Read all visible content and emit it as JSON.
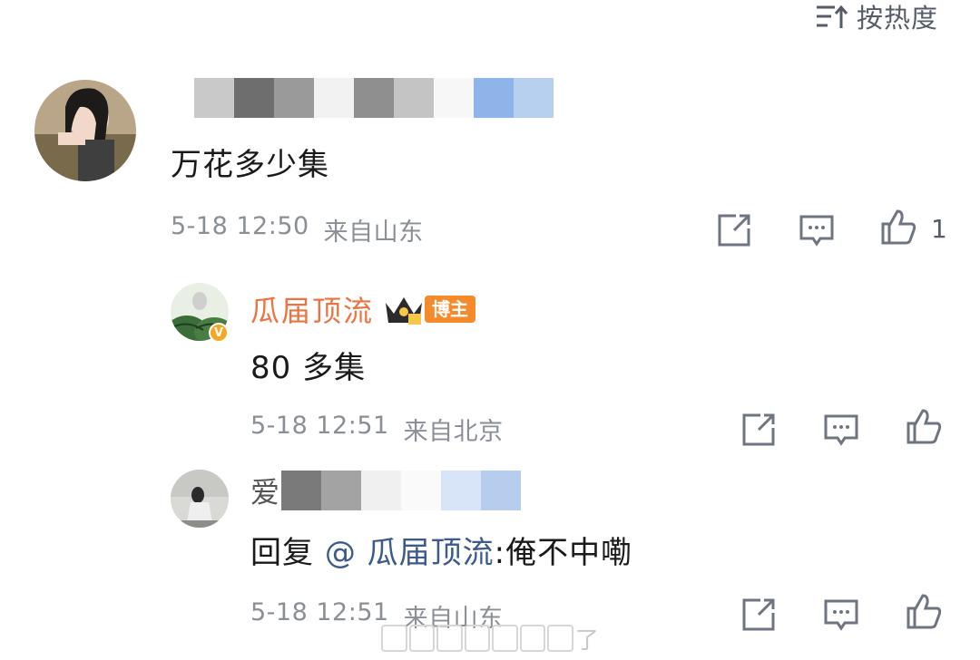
{
  "sort": {
    "label": "按热度",
    "icon": "sort-icon"
  },
  "comments": [
    {
      "author": "",
      "text": "万花多少集",
      "time": "5-18 12:50",
      "location": "来自山东",
      "likes": "1"
    }
  ],
  "replies": [
    {
      "author": "瓜届顶流",
      "badge": "博主",
      "verified": "V",
      "text": "80 多集",
      "time": "5-18 12:51",
      "location": "来自北京"
    },
    {
      "author_visible": "爱",
      "text_prefix": "回复",
      "mention": "@ 瓜届顶流",
      "text_suffix": ":俺不中嘞",
      "time": "5-18 12:51",
      "location": "来自山东"
    }
  ],
  "watermark_tail": "了",
  "colors": {
    "accent_orange": "#eb7340",
    "mention_blue": "#3c5a8c",
    "meta_gray": "#8a8f96",
    "icon_gray": "#6e7580"
  }
}
